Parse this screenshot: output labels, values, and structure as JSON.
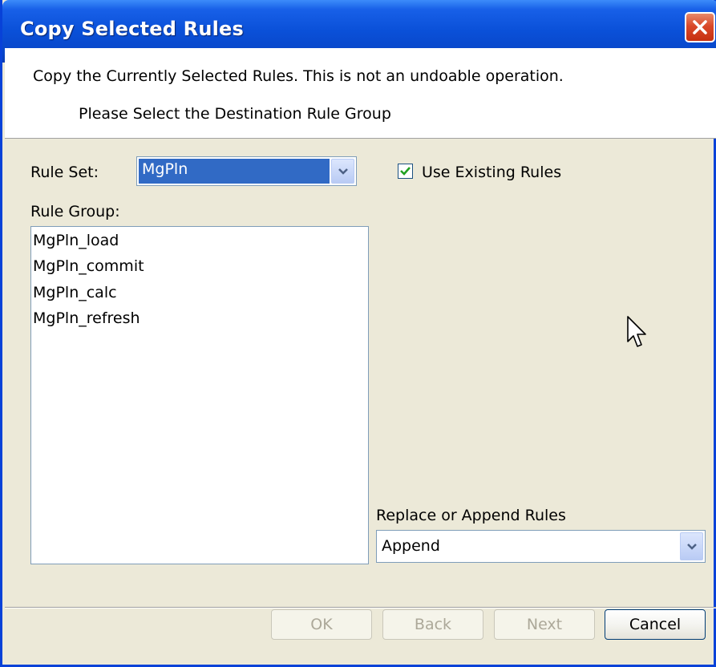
{
  "window": {
    "title": "Copy Selected Rules"
  },
  "header": {
    "description": "Copy the Currently Selected Rules. This is not an undoable operation.",
    "instruction": "Please Select the Destination Rule Group"
  },
  "rule_set": {
    "label": "Rule Set:",
    "value": "MgPln"
  },
  "use_existing": {
    "label": "Use Existing Rules",
    "checked": true
  },
  "rule_group": {
    "label": "Rule Group:",
    "items": [
      "MgPln_load",
      "MgPln_commit",
      "MgPln_calc",
      "MgPln_refresh"
    ]
  },
  "replace_append": {
    "label": "Replace or Append Rules",
    "value": "Append"
  },
  "buttons": {
    "ok": "OK",
    "back": "Back",
    "next": "Next",
    "cancel": "Cancel"
  },
  "colors": {
    "title_bar": "#0a50d8",
    "selection": "#316ac5",
    "dialog_bg": "#ece9d8",
    "close_button": "#d9492a"
  },
  "icons": [
    "close-icon",
    "chevron-down-icon",
    "checkmark-icon",
    "mouse-pointer-icon"
  ]
}
